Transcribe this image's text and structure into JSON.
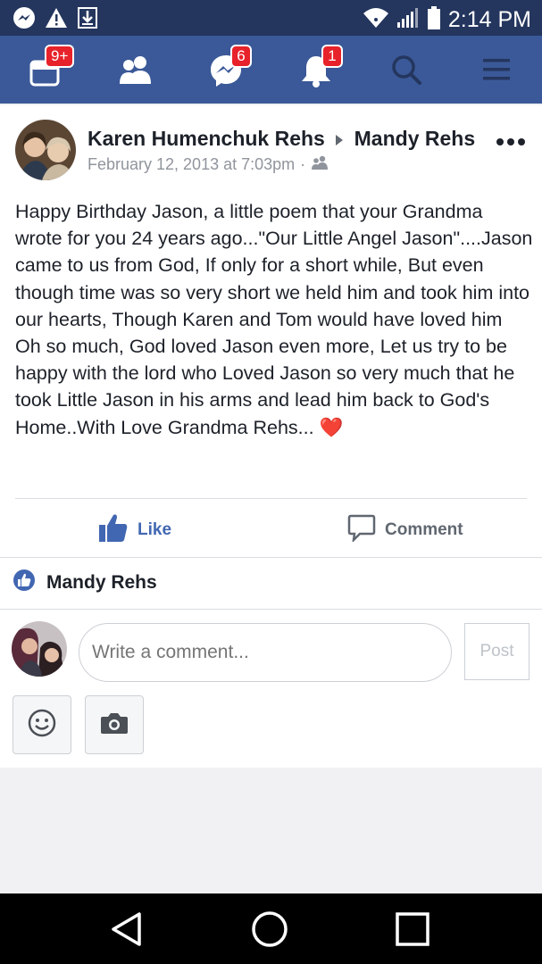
{
  "status_bar": {
    "time": "2:14 PM",
    "icons": [
      "messenger-icon",
      "warning-icon",
      "download-icon",
      "wifi-icon",
      "signal-icon",
      "battery-icon"
    ]
  },
  "navbar": {
    "background": "#3b5998",
    "items": [
      {
        "icon": "feed-icon",
        "badge": "9+"
      },
      {
        "icon": "friends-icon",
        "badge": ""
      },
      {
        "icon": "messenger-icon",
        "badge": "6"
      },
      {
        "icon": "notifications-icon",
        "badge": "1"
      },
      {
        "icon": "search-icon",
        "badge": ""
      },
      {
        "icon": "menu-icon",
        "badge": ""
      }
    ]
  },
  "post": {
    "author": "Karen Humenchuk Rehs",
    "recipient": "Mandy Rehs",
    "date": "February 12, 2013 at 7:03pm",
    "privacy_icon": "friends-icon",
    "text": "Happy Birthday Jason, a little poem that your Grandma wrote for you 24 years ago...\"Our Little Angel Jason\"....Jason came to us from God, If only for a short while, But even though time was so very short we held him and took him into our hearts, Though Karen and Tom would have loved him Oh so much, God loved Jason even more, Let us try to be happy with the lord who Loved Jason so very much that he took Little Jason in his arms and lead him back to God's Home..With Love Grandma Rehs...",
    "emoji": "❤️"
  },
  "actions": {
    "like_label": "Like",
    "comment_label": "Comment",
    "like_color": "#4267b2",
    "comment_color": "#606770"
  },
  "likes": {
    "name": "Mandy Rehs"
  },
  "comment_box": {
    "placeholder": "Write a comment...",
    "post_label": "Post",
    "tools": [
      "emoji-icon",
      "camera-icon"
    ]
  },
  "system_nav": [
    "back-icon",
    "home-icon",
    "recents-icon"
  ]
}
